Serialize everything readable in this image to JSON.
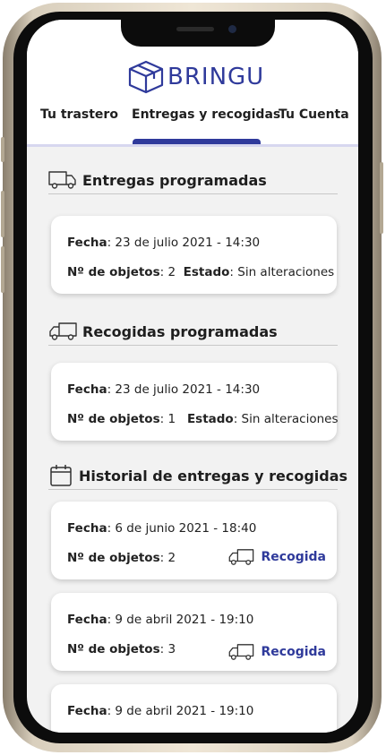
{
  "app": {
    "brand": "BRINGU"
  },
  "tabs": [
    {
      "label": "Tu trastero"
    },
    {
      "label": "Entregas y recogidas"
    },
    {
      "label": "Tu Cuenta"
    }
  ],
  "labels": {
    "date": "Fecha",
    "objects": "Nº de objetos",
    "state": "Estado"
  },
  "sections": {
    "deliveries": {
      "title": "Entregas programadas",
      "card": {
        "date": "23 de julio 2021 - 14:30",
        "objects": "2",
        "state": "Sin alteraciones"
      }
    },
    "pickups": {
      "title": "Recogidas programadas",
      "card": {
        "date": "23 de julio 2021 - 14:30",
        "objects": "1",
        "state": "Sin alteraciones"
      }
    },
    "history": {
      "title": "Historial de entregas y recogidas",
      "items": [
        {
          "date": "6 de junio  2021 - 18:40",
          "objects": "2",
          "type": "Recogida"
        },
        {
          "date": "9 de abril 2021 - 19:10",
          "objects": "3",
          "type": "Recogida"
        },
        {
          "date": "9 de abril 2021 - 19:10"
        }
      ]
    }
  },
  "colors": {
    "brand": "#2f3a9b",
    "frame": "#d9cfbd"
  },
  "icons": [
    "truck-icon",
    "calendar-icon",
    "box-logo-icon"
  ]
}
